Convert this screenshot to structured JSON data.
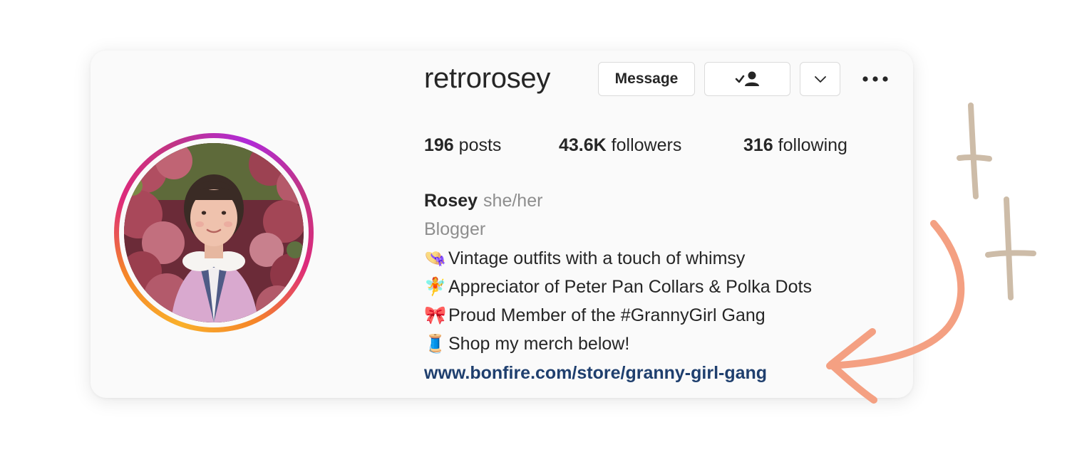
{
  "profile": {
    "username": "retrorosey",
    "message_label": "Message"
  },
  "stats": {
    "posts_count": "196",
    "posts_label": "posts",
    "followers_count": "43.6K",
    "followers_label": "followers",
    "following_count": "316",
    "following_label": "following"
  },
  "bio": {
    "name": "Rosey",
    "pronouns": "she/her",
    "category": "Blogger",
    "lines": [
      {
        "icon": "pink-flower-hat-emoji",
        "glyph": "👒",
        "text": "Vintage outfits with a touch of whimsy"
      },
      {
        "icon": "fairy-emoji",
        "glyph": "🧚",
        "text": "Appreciator of Peter Pan Collars & Polka Dots"
      },
      {
        "icon": "ribbon-emoji",
        "glyph": "🎀",
        "text": "Proud Member of the #GrannyGirl Gang"
      },
      {
        "icon": "thread-spool-emoji",
        "glyph": "🧵",
        "text": "Shop my merch below!"
      }
    ],
    "link": "www.bonfire.com/store/granny-girl-gang"
  },
  "icons": {
    "following": "person-check-icon",
    "dropdown": "chevron-down-icon",
    "more": "more-options-icon"
  },
  "colors": {
    "card_background": "#fafafa",
    "link": "#1f3f6e",
    "secondary_text": "#8e8e8e",
    "annotation_arrow": "#f4a082",
    "sparkle": "#cdbca8"
  }
}
